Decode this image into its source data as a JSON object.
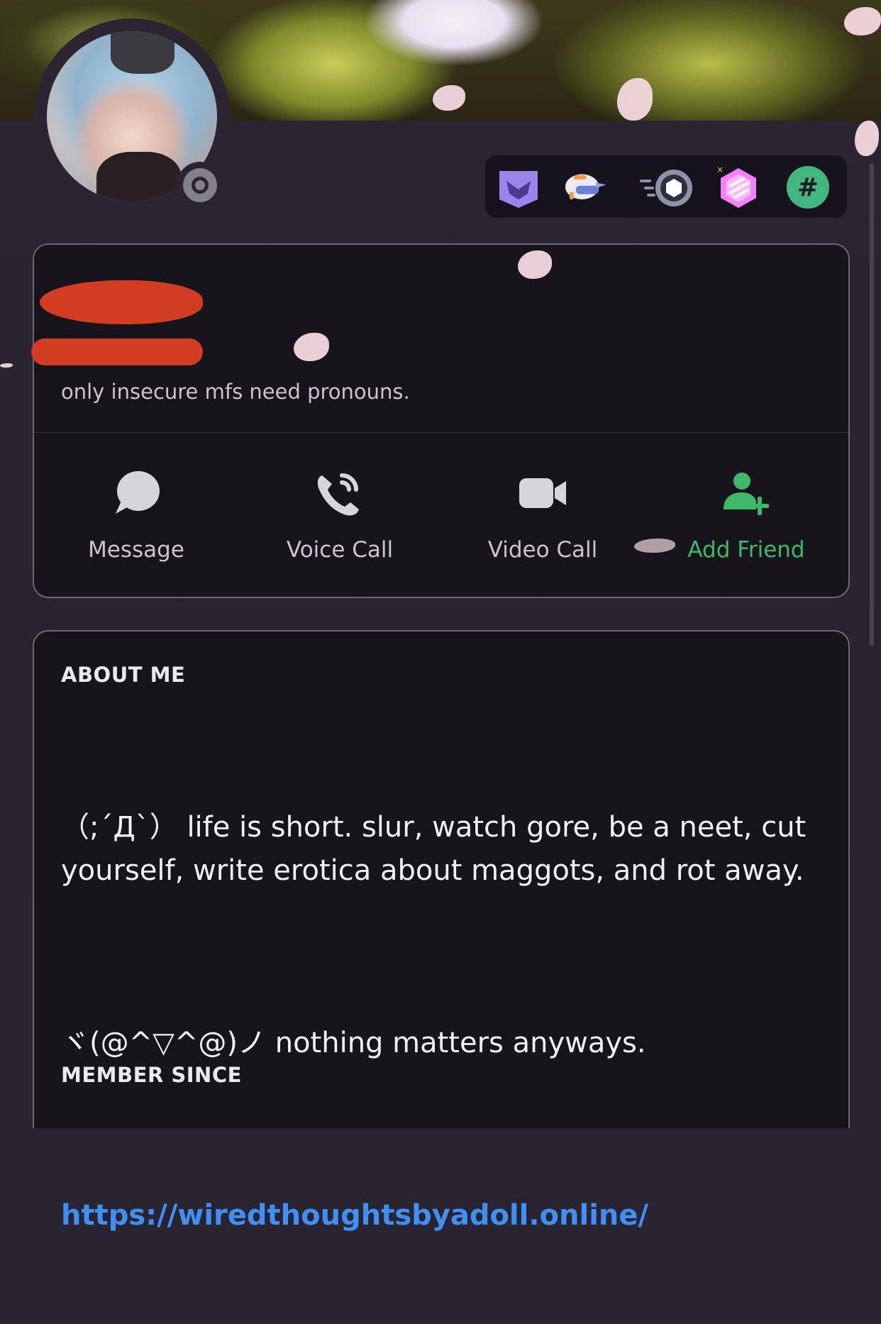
{
  "profile": {
    "pronouns": "only insecure mfs need pronouns.",
    "status_icon": "offline-status-icon"
  },
  "badges": [
    {
      "name": "hypesquad-bravery-badge",
      "color": "#9b84ec"
    },
    {
      "name": "early-supporter-helmet-badge",
      "color": "#dfe4f7"
    },
    {
      "name": "nitro-boost-badge",
      "color": "#8f92a6"
    },
    {
      "name": "server-booster-gem-badge",
      "color": "#f47fff"
    },
    {
      "name": "legacy-username-badge",
      "color": "#43b581"
    }
  ],
  "actions": {
    "message": "Message",
    "voice_call": "Voice Call",
    "video_call": "Video Call",
    "add_friend": "Add Friend"
  },
  "about": {
    "title": "ABOUT ME",
    "line1": "（;´Д`） life is short. slur, watch gore, be a neet, cut yourself, write erotica about maggots, and rot away.",
    "line2": "ヾ(@^▽^@)ノ nothing matters anyways.",
    "link": "https://wiredthoughtsbyadoll.online/"
  },
  "member_since": {
    "title": "MEMBER SINCE"
  },
  "colors": {
    "background": "#2a2430",
    "card": "#17141c",
    "card_border": "#6e6673",
    "link": "#3f8ff5",
    "add_friend": "#3fb968",
    "redaction": "#d13c23"
  }
}
